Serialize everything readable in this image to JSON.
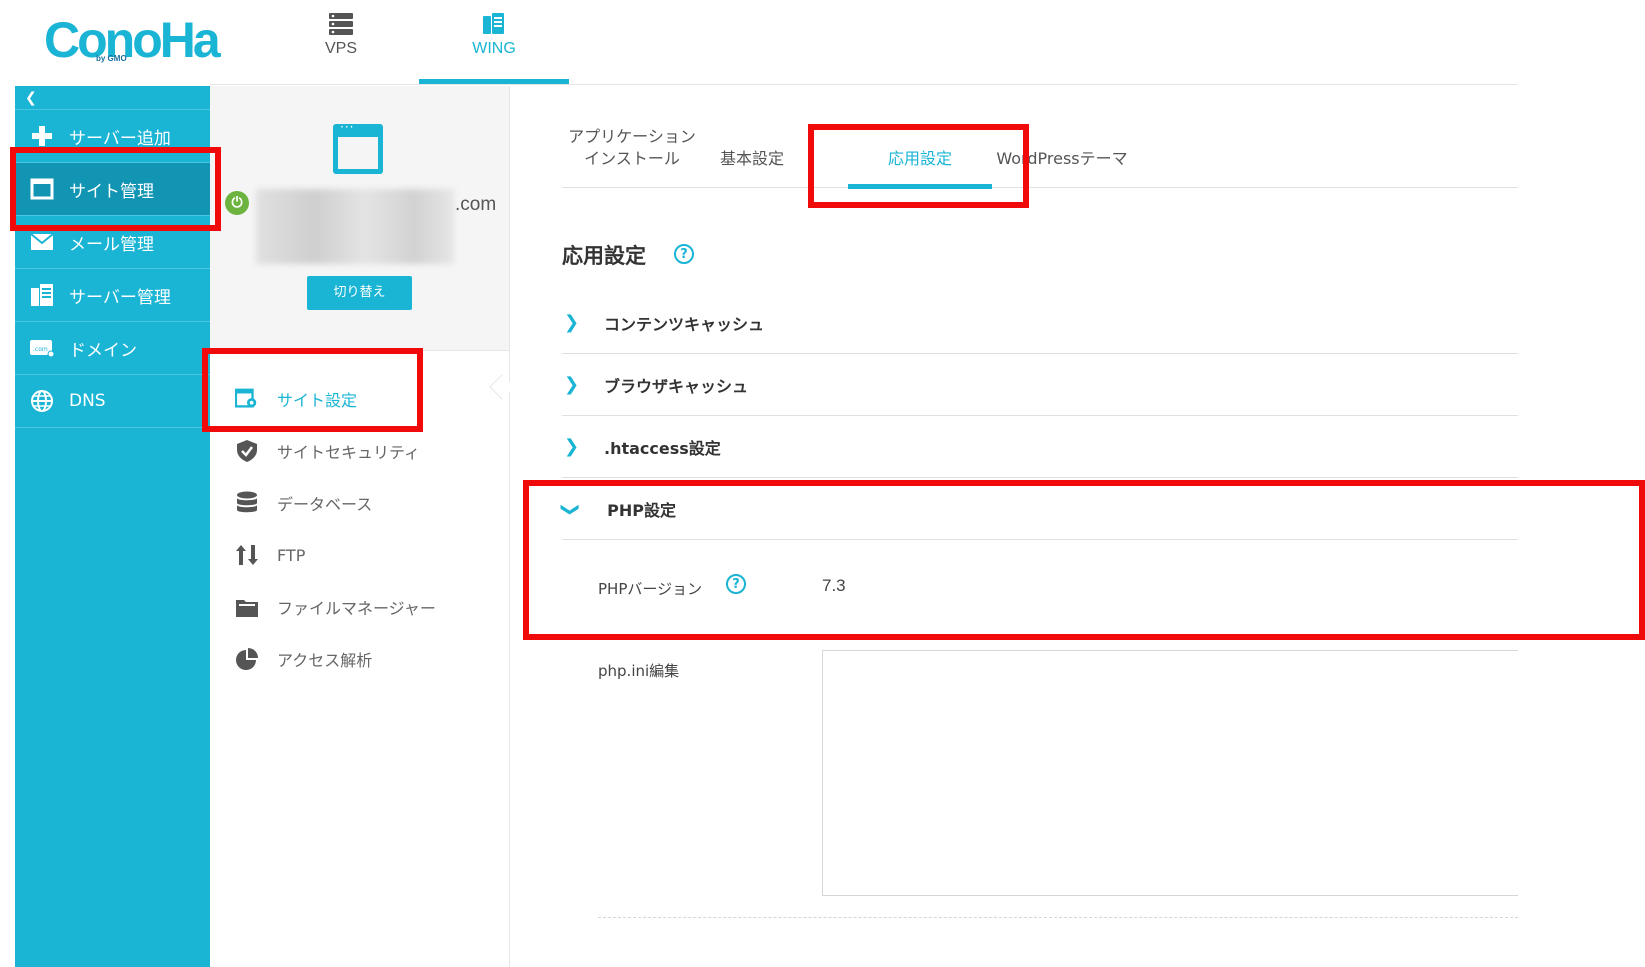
{
  "logo": {
    "text": "ConoHa",
    "sub": "by GMO"
  },
  "top_tabs": {
    "vps": "VPS",
    "wing": "WING"
  },
  "sidebar": {
    "collapse_icon": "chevron-left-icon",
    "items": [
      {
        "label": "サーバー追加",
        "icon": "plus-icon"
      },
      {
        "label": "サイト管理",
        "icon": "window-icon"
      },
      {
        "label": "メール管理",
        "icon": "mail-icon"
      },
      {
        "label": "サーバー管理",
        "icon": "server-icon"
      },
      {
        "label": "ドメイン",
        "icon": "domain-icon"
      },
      {
        "label": "DNS",
        "icon": "globe-icon"
      }
    ],
    "active": "サイト管理"
  },
  "site": {
    "domain_tld": ".com",
    "switch_label": "切り替え",
    "status": "power-on"
  },
  "subnav": {
    "items": [
      {
        "label": "サイト設定",
        "icon": "site-settings-icon"
      },
      {
        "label": "サイトセキュリティ",
        "icon": "shield-icon"
      },
      {
        "label": "データベース",
        "icon": "database-icon"
      },
      {
        "label": "FTP",
        "icon": "transfer-arrows-icon"
      },
      {
        "label": "ファイルマネージャー",
        "icon": "folder-icon"
      },
      {
        "label": "アクセス解析",
        "icon": "pie-chart-icon"
      }
    ],
    "active": "サイト設定"
  },
  "tabs": {
    "app_install_line1": "アプリケーション",
    "app_install_line2": "インストール",
    "basic": "基本設定",
    "advanced": "応用設定",
    "wordpress": "WordPressテーマ",
    "active": "応用設定"
  },
  "main": {
    "title": "応用設定",
    "help": "?",
    "sections": {
      "contents_cache": "コンテンツキャッシュ",
      "browser_cache": "ブラウザキャッシュ",
      "htaccess": ".htaccess設定",
      "php": "PHP設定"
    },
    "php_version_label": "PHPバージョン",
    "php_version_value": "7.3",
    "php_ini_label": "php.ini編集"
  },
  "colors": {
    "accent": "#1ab4d4",
    "sidebar_active": "#1295b3",
    "highlight": "#f00a0a",
    "power": "#6cb33f"
  }
}
